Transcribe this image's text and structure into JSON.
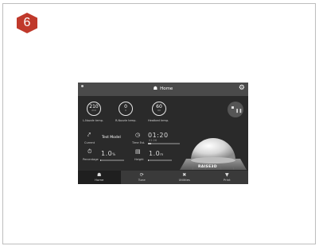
{
  "step_badge": "6",
  "topbar": {
    "title": "Home",
    "icon": "home-icon",
    "settings_icon": "gear-icon"
  },
  "gauges": [
    {
      "value": "210",
      "target": "210",
      "label": "L-Nozzle temp."
    },
    {
      "value": "0",
      "target": "0",
      "label": "R-Nozzle temp."
    },
    {
      "value": "60",
      "target": "60",
      "label": "Heatbed temp."
    }
  ],
  "pause_button": {
    "icon": "pause-icon"
  },
  "current": {
    "label": "Current",
    "value": "Test Model",
    "icon": "cursor-icon"
  },
  "time": {
    "label": "Time Est.",
    "value": "01:20",
    "sub": "01:26"
  },
  "percentage": {
    "label": "Percentage",
    "value": "1.0",
    "unit": "%",
    "progress": 0.01
  },
  "height": {
    "label": "Height",
    "value": "1.0",
    "unit": "m",
    "progress": 0.01
  },
  "brand": "RAISE3D",
  "nav": [
    {
      "label": "Home",
      "icon": "home-icon",
      "active": true
    },
    {
      "label": "Tune",
      "icon": "tune-icon",
      "active": false
    },
    {
      "label": "Utilities",
      "icon": "utilities-icon",
      "active": false
    },
    {
      "label": "Print",
      "icon": "print-icon",
      "active": false
    }
  ],
  "colors": {
    "badge": "#c0392b",
    "screen_bg": "#2a2a2a",
    "topbar_bg": "#4a4a4a"
  }
}
